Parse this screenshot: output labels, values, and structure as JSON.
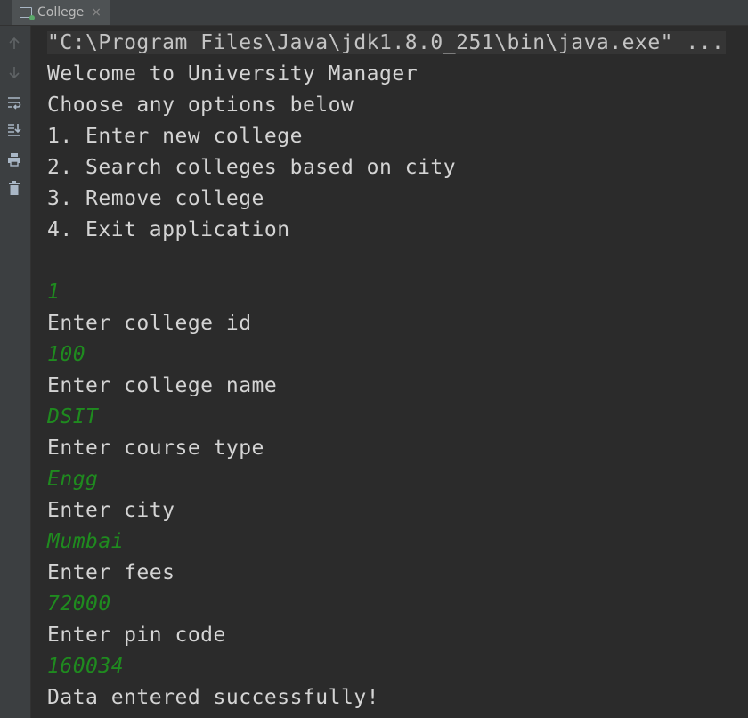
{
  "tab": {
    "title": "College",
    "close_glyph": "×"
  },
  "gutter": {
    "buttons": [
      {
        "name": "arrow-up-icon",
        "icon": "arrow-up"
      },
      {
        "name": "arrow-down-icon",
        "icon": "arrow-down"
      },
      {
        "name": "soft-wrap-icon",
        "icon": "soft-wrap"
      },
      {
        "name": "scroll-to-end-icon",
        "icon": "scroll-to-end"
      },
      {
        "name": "print-icon",
        "icon": "print"
      },
      {
        "name": "trash-icon",
        "icon": "trash"
      }
    ]
  },
  "console": {
    "command": "\"C:\\Program Files\\Java\\jdk1.8.0_251\\bin\\java.exe\" ...",
    "lines": [
      {
        "text": "Welcome to University Manager",
        "kind": "output"
      },
      {
        "text": "Choose any options below",
        "kind": "output"
      },
      {
        "text": "1. Enter new college",
        "kind": "output"
      },
      {
        "text": "2. Search colleges based on city",
        "kind": "output"
      },
      {
        "text": "3. Remove college",
        "kind": "output"
      },
      {
        "text": "4. Exit application",
        "kind": "output"
      },
      {
        "text": "",
        "kind": "output"
      },
      {
        "text": "1",
        "kind": "input"
      },
      {
        "text": "Enter college id",
        "kind": "output"
      },
      {
        "text": "100",
        "kind": "input"
      },
      {
        "text": "Enter college name",
        "kind": "output"
      },
      {
        "text": "DSIT",
        "kind": "input"
      },
      {
        "text": "Enter course type",
        "kind": "output"
      },
      {
        "text": "Engg",
        "kind": "input"
      },
      {
        "text": "Enter city",
        "kind": "output"
      },
      {
        "text": "Mumbai",
        "kind": "input"
      },
      {
        "text": "Enter fees",
        "kind": "output"
      },
      {
        "text": "72000",
        "kind": "input"
      },
      {
        "text": "Enter pin code",
        "kind": "output"
      },
      {
        "text": "160034",
        "kind": "input"
      },
      {
        "text": "Data entered successfully!",
        "kind": "output"
      }
    ]
  },
  "colors": {
    "background": "#2b2b2b",
    "output_text": "#d4d4d4",
    "input_text": "#1f8b1f",
    "icon": "#a9b7c6",
    "icon_disabled": "#5f6365"
  }
}
